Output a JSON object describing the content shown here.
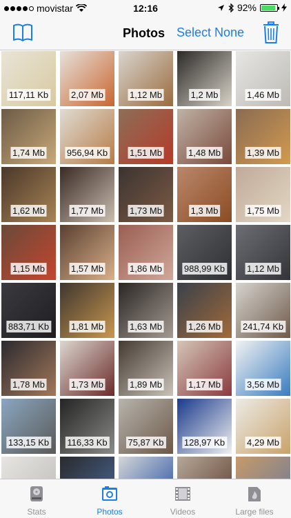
{
  "status": {
    "carrier": "movistar",
    "time": "12:16",
    "battery": "92%",
    "battery_level": 0.92
  },
  "nav": {
    "title": "Photos",
    "action": "Select None"
  },
  "photos": [
    {
      "size": "117,11 Kb",
      "colors": [
        "#e9e4d6",
        "#d7c9a1"
      ]
    },
    {
      "size": "2,07 Mb",
      "colors": [
        "#e6e1dc",
        "#c9662f"
      ]
    },
    {
      "size": "1,12 Mb",
      "colors": [
        "#d9d5cf",
        "#9a6b3e"
      ]
    },
    {
      "size": "1,2 Mb",
      "colors": [
        "#2c2a28",
        "#d8d3c8"
      ]
    },
    {
      "size": "1,46 Mb",
      "colors": [
        "#e6e6e3",
        "#bdbab4"
      ]
    },
    {
      "size": "1,74 Mb",
      "colors": [
        "#6b5a45",
        "#c8a97a"
      ]
    },
    {
      "size": "956,94 Kb",
      "colors": [
        "#dfdcd4",
        "#b77b45"
      ]
    },
    {
      "size": "1,51 Mb",
      "colors": [
        "#8d6f59",
        "#b53a28"
      ]
    },
    {
      "size": "1,48 Mb",
      "colors": [
        "#bfb2a6",
        "#7a4a3a"
      ]
    },
    {
      "size": "1,39 Mb",
      "colors": [
        "#8a6b52",
        "#d29a50"
      ]
    },
    {
      "size": "1,62 Mb",
      "colors": [
        "#4a382a",
        "#a88456"
      ]
    },
    {
      "size": "1,77 Mb",
      "colors": [
        "#3a2a24",
        "#c9bdb0"
      ]
    },
    {
      "size": "1,73 Mb",
      "colors": [
        "#3b3431",
        "#7d5a44"
      ]
    },
    {
      "size": "1,3 Mb",
      "colors": [
        "#b9876c",
        "#8c4c22"
      ]
    },
    {
      "size": "1,75 Mb",
      "colors": [
        "#c0aa98",
        "#e3d7c5"
      ]
    },
    {
      "size": "1,15 Mb",
      "colors": [
        "#6a4a3a",
        "#c4452e"
      ]
    },
    {
      "size": "1,57 Mb",
      "colors": [
        "#5a4031",
        "#d9b089"
      ]
    },
    {
      "size": "1,86 Mb",
      "colors": [
        "#9b5e52",
        "#cfa89a"
      ]
    },
    {
      "size": "988,99 Kb",
      "colors": [
        "#5d5e62",
        "#2d2f33"
      ]
    },
    {
      "size": "1,12 Mb",
      "colors": [
        "#6d6e74",
        "#333338"
      ]
    },
    {
      "size": "883,71 Kb",
      "colors": [
        "#3b3b3f",
        "#1e1e22"
      ]
    },
    {
      "size": "1,81 Mb",
      "colors": [
        "#3f362f",
        "#c8974f"
      ]
    },
    {
      "size": "1,63 Mb",
      "colors": [
        "#2a2624",
        "#a49a92"
      ]
    },
    {
      "size": "1,26 Mb",
      "colors": [
        "#39414a",
        "#a26a3b"
      ]
    },
    {
      "size": "241,74 Kb",
      "colors": [
        "#d5d3ce",
        "#6f5a4a"
      ]
    },
    {
      "size": "1,78 Mb",
      "colors": [
        "#2c2a2f",
        "#a2785a"
      ]
    },
    {
      "size": "1,73 Mb",
      "colors": [
        "#dcd6d0",
        "#6a2a28"
      ]
    },
    {
      "size": "1,89 Mb",
      "colors": [
        "#443a33",
        "#c9c2b7"
      ]
    },
    {
      "size": "1,17 Mb",
      "colors": [
        "#d3c6b8",
        "#8c3a3e"
      ]
    },
    {
      "size": "3,56 Mb",
      "colors": [
        "#f2f2f2",
        "#3a7cbf"
      ]
    },
    {
      "size": "133,15 Kb",
      "colors": [
        "#8aa6c0",
        "#5a5a58"
      ]
    },
    {
      "size": "116,33 Kb",
      "colors": [
        "#242424",
        "#8a8a88"
      ]
    },
    {
      "size": "75,87 Kb",
      "colors": [
        "#b7b4ad",
        "#6c5848"
      ]
    },
    {
      "size": "128,97 Kb",
      "colors": [
        "#1a3a8c",
        "#f0f0f0"
      ]
    },
    {
      "size": "4,29 Mb",
      "colors": [
        "#ecebe6",
        "#c9a26a"
      ]
    }
  ],
  "partial_row": [
    {
      "colors": [
        "#e7e5e1",
        "#bcbab5"
      ]
    },
    {
      "colors": [
        "#2a2a2c",
        "#4a6a9a"
      ]
    },
    {
      "colors": [
        "#d5d6d8",
        "#1c4aa0"
      ]
    },
    {
      "colors": [
        "#b6a89a",
        "#5a3a2a"
      ]
    },
    {
      "colors": [
        "#c79a6a",
        "#6a7a9a"
      ]
    }
  ],
  "tabs": [
    {
      "label": "Stats",
      "icon": "disk-drive-icon",
      "active": false
    },
    {
      "label": "Photos",
      "icon": "photo-icon",
      "active": true
    },
    {
      "label": "Videos",
      "icon": "film-icon",
      "active": false
    },
    {
      "label": "Large files",
      "icon": "large-file-icon",
      "active": false
    }
  ],
  "colors": {
    "accent": "#1a7ee8",
    "inactive": "#929292",
    "battery": "#4cd964"
  }
}
